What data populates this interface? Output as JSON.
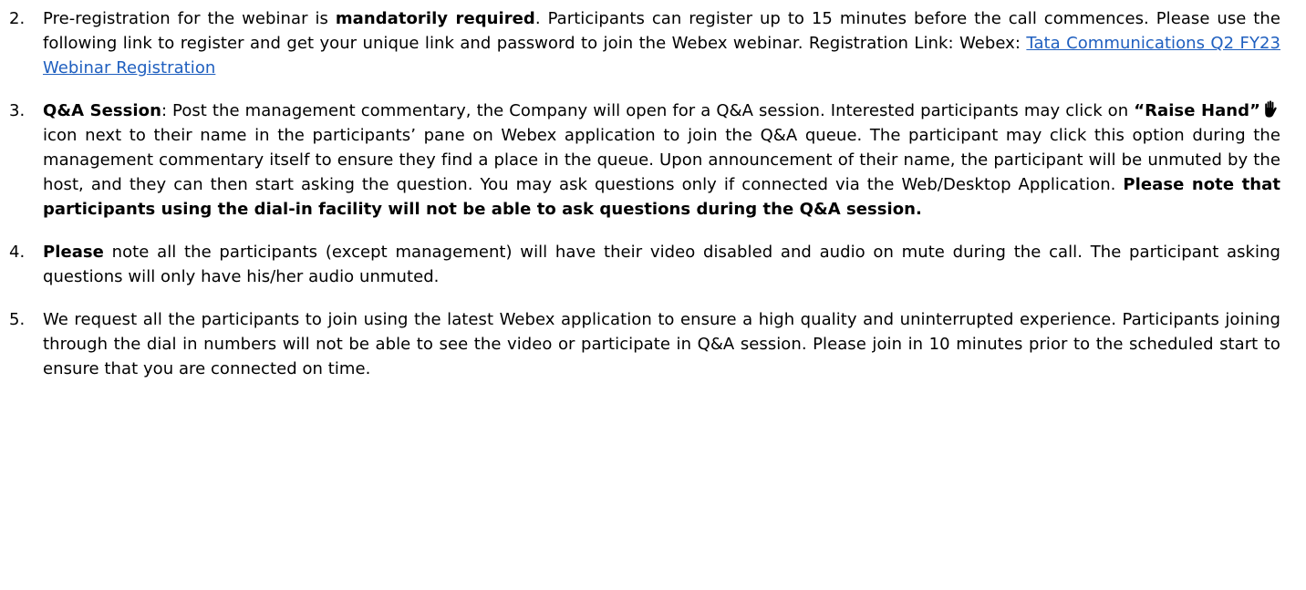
{
  "document": {
    "items": [
      {
        "number": "2.",
        "segments": [
          {
            "text": "Pre-registration for the webinar is ",
            "bold": false
          },
          {
            "text": "mandatorily required",
            "bold": true
          },
          {
            "text": ". Participants can register up to 15 minutes before the call commences. Please use the following link to register and get your unique link and password to join the Webex webinar. Registration Link: Webex: ",
            "bold": false
          },
          {
            "text": "Tata Communications Q2 FY23 Webinar Registration",
            "link": true
          }
        ]
      },
      {
        "number": "3.",
        "segments": [
          {
            "text": "Q&A Session",
            "bold": true
          },
          {
            "text": ": Post the management commentary, the Company will open for a Q&A session. Interested participants may click on ",
            "bold": false
          },
          {
            "text": "“Raise Hand”",
            "bold": true
          },
          {
            "icon": "raise-hand-icon"
          },
          {
            "text": " icon next to their name in the participants’ pane on Webex application to join the Q&A queue. The participant may click this option during the management commentary itself to ensure they find a place in the queue. Upon announcement of their name, the participant will be unmuted by the host, and they can then start asking the question. You may ask questions only if connected via the Web/Desktop Application. ",
            "bold": false
          },
          {
            "text": "Please note that participants using the dial-in facility will not be able to ask questions during the Q&A session.",
            "bold": true
          }
        ]
      },
      {
        "number": "4.",
        "segments": [
          {
            "text": "Please",
            "bold": true
          },
          {
            "text": " note all the participants (except management) will have their video disabled and audio on mute during the call. The participant asking questions will only have his/her audio unmuted.",
            "bold": false
          }
        ]
      },
      {
        "number": "5.",
        "segments": [
          {
            "text": "We request all the participants to join using the latest Webex application to ensure a high quality and uninterrupted experience. Participants joining through the dial in numbers will not be able to see the video or participate in Q&A session. Please join in 10 minutes prior to the scheduled start to ensure that you are connected on time.",
            "bold": false
          }
        ]
      }
    ]
  },
  "colors": {
    "text": "#000000",
    "link": "#1f5fbf",
    "background": "#ffffff"
  }
}
